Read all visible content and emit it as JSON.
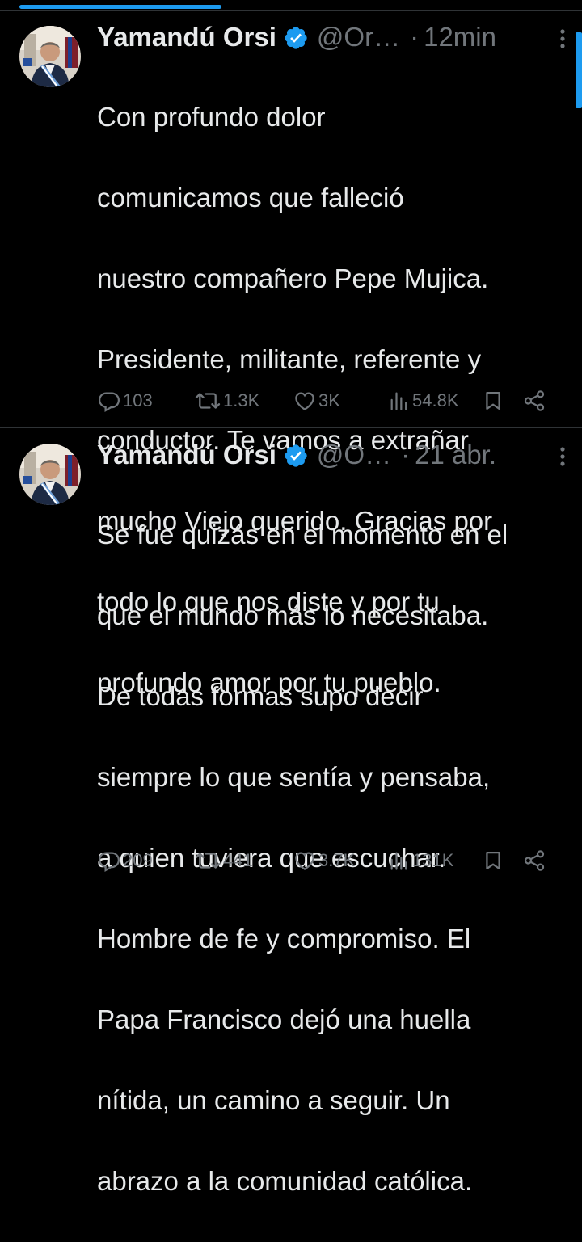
{
  "tweets": [
    {
      "author": {
        "name": "Yamandú Orsi",
        "handle": "@Or…",
        "verified": true
      },
      "time": "12min",
      "text": "Con profundo dolor comunicamos que falleció nuestro compañero Pepe Mujica. Presidente, militante, referente y conductor. Te vamos a extrañar mucho Viejo querido. Gracias por todo lo que nos diste y por tu profundo amor por tu pueblo.",
      "lines": [
        "Con profundo dolor",
        "comunicamos que falleció",
        "nuestro compañero Pepe Mujica.",
        "Presidente, militante, referente y",
        "conductor. Te vamos a extrañar",
        "mucho Viejo querido. Gracias por",
        "todo lo que nos diste y por tu",
        "profundo amor por tu pueblo."
      ],
      "stats": {
        "replies": "103",
        "reposts": "1.3K",
        "likes": "3K",
        "views": "54.8K"
      }
    },
    {
      "author": {
        "name": "Yamandú Orsi",
        "handle": "@O…",
        "verified": true
      },
      "time": "21 abr.",
      "text": "Se fue quizás en el momento en el que el mundo más lo necesitaba. De todas formas supo decir siempre lo que sentía y pensaba, a quien tuviera que escuchar. Hombre de fe y compromiso. El Papa Francisco dejó una huella nítida, un camino a seguir. Un abrazo a la comunidad católica.",
      "lines": [
        "Se fue quizás en el momento en el",
        "que el mundo más lo necesitaba.",
        "De todas formas supo decir",
        "siempre lo que sentía y pensaba,",
        "a quien tuviera que escuchar.",
        "Hombre de fe y compromiso. El",
        "Papa Francisco dejó una huella",
        "nítida, un camino a seguir. Un",
        "abrazo a la comunidad católica."
      ],
      "stats": {
        "replies": "209",
        "reposts": "441",
        "likes": "3.7K",
        "views": "131K"
      }
    }
  ],
  "icons": {
    "verified": "verified-badge-icon",
    "more": "more-vertical-icon",
    "reply": "reply-icon",
    "repost": "repost-icon",
    "like": "heart-icon",
    "views": "views-bar-icon",
    "bookmark": "bookmark-icon",
    "share": "share-icon"
  },
  "colors": {
    "background": "#000000",
    "text": "#e7e9ea",
    "secondary": "#71767b",
    "accent": "#1d9bf0",
    "divider": "#2f3336"
  }
}
